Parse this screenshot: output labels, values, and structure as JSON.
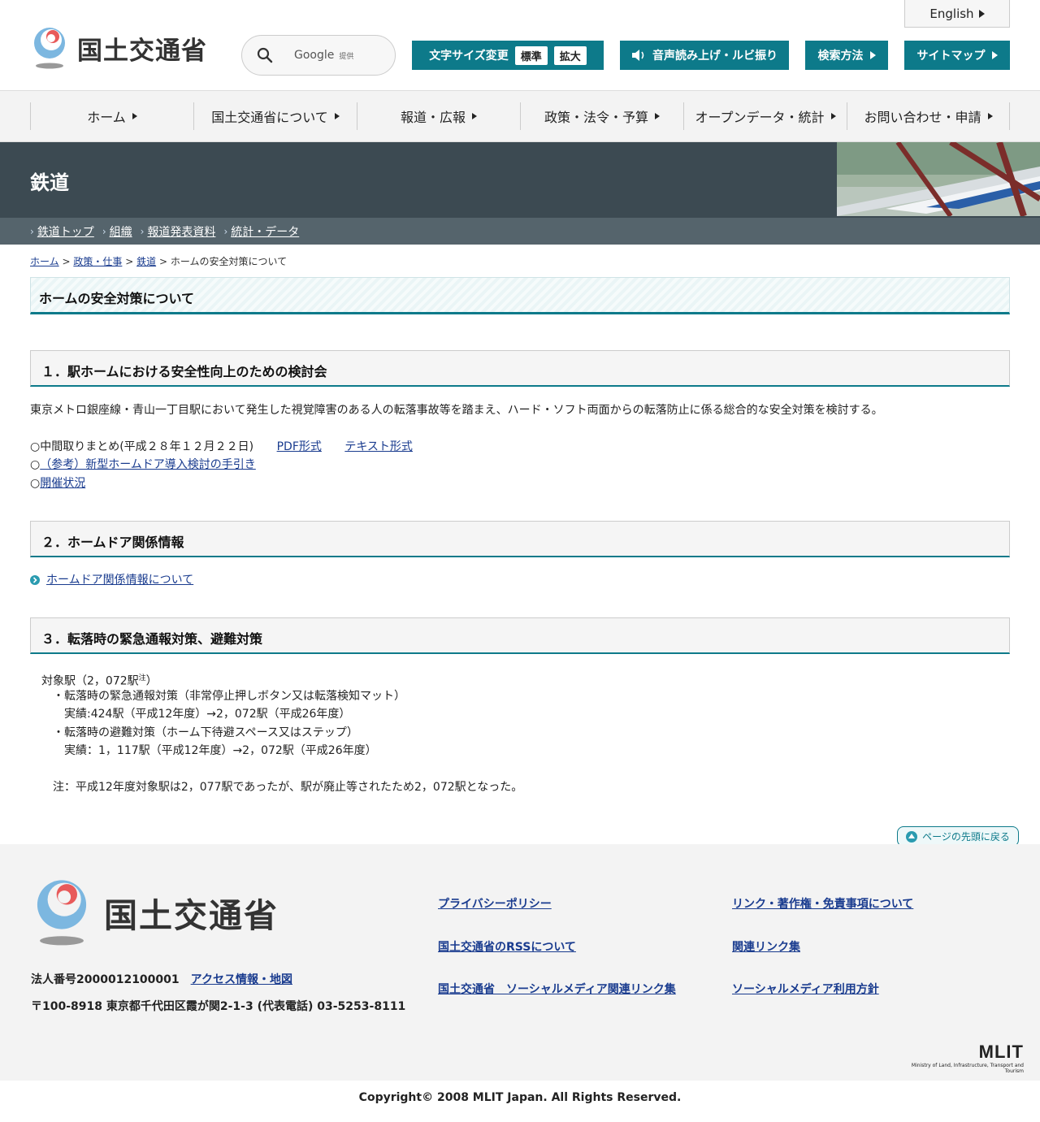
{
  "header": {
    "logo_text": "国土交通省",
    "english_label": "English",
    "search": {
      "provider": "Google",
      "provider_note": "提供"
    },
    "font_size": {
      "label": "文字サイズ変更",
      "standard": "標準",
      "large": "拡大"
    },
    "speech_label": "音声読み上げ・ルビ振り",
    "search_method_label": "検索方法",
    "sitemap_label": "サイトマップ"
  },
  "nav": {
    "items": [
      {
        "label": "ホーム"
      },
      {
        "label": "国土交通省について"
      },
      {
        "label": "報道・広報"
      },
      {
        "label": "政策・法令・予算"
      },
      {
        "label": "オープンデータ・統計"
      },
      {
        "label": "お問い合わせ・申請"
      }
    ]
  },
  "section": {
    "title": "鉄道",
    "subnav": [
      {
        "label": "鉄道トップ"
      },
      {
        "label": "組織"
      },
      {
        "label": "報道発表資料"
      },
      {
        "label": "統計・データ"
      }
    ]
  },
  "breadcrumb": {
    "home": "ホーム",
    "policy": "政策・仕事",
    "railway": "鉄道",
    "current": "ホームの安全対策について",
    "sep": ">"
  },
  "page": {
    "title": "ホームの安全対策について",
    "s1": {
      "heading": "１．駅ホームにおける安全性向上のための検討会",
      "body": "東京メトロ銀座線・青山一丁目駅において発生した視覚障害のある人の転落事故等を踏まえ、ハード・ソフト両面からの転落防止に係る総合的な安全対策を検討する。",
      "interim_prefix": "○中間取りまとめ(平成２８年１２月２２日)",
      "pdf_link": "PDF形式",
      "text_link": "テキスト形式",
      "bullet": "○",
      "guide_link": "（参考）新型ホームドア導入検討の手引き",
      "status_link": "開催状況"
    },
    "s2": {
      "heading": "２．ホームドア関係情報",
      "link": "ホームドア関係情報について"
    },
    "s3": {
      "heading": "３．転落時の緊急通報対策、避難対策",
      "target": "対象駅（2，072駅",
      "note_mark": "注",
      "target_close": "）",
      "line1": "・転落時の緊急通報対策（非常停止押しボタン又は転落検知マット）",
      "line2": "実績:424駅（平成12年度）→2，072駅（平成26年度）",
      "line3": "・転落時の避難対策（ホーム下待避スペース又はステップ）",
      "line4": "実績：1，117駅（平成12年度）→2，072駅（平成26年度）",
      "note": "注：平成12年度対象駅は2，077駅であったが、駅が廃止等されたため2，072駅となった。"
    },
    "to_top": "ページの先頭に戻る"
  },
  "footer": {
    "logo_text": "国土交通省",
    "corp_number": "法人番号2000012100001",
    "access_link": "アクセス情報・地図",
    "address": "〒100-8918 東京都千代田区霞が関2-1-3 (代表電話) 03-5253-8111",
    "links": {
      "privacy": "プライバシーポリシー",
      "link_copyright": "リンク・著作権・免責事項について",
      "rss": "国土交通省のRSSについて",
      "related": "関連リンク集",
      "social_links": "国土交通省　ソーシャルメディア関連リンク集",
      "social_policy": "ソーシャルメディア利用方針"
    },
    "mlit_mark": "MLIT",
    "mlit_full": "Ministry of Land, Infrastructure, Transport and Tourism",
    "copyright": "Copyright© 2008 MLIT Japan. All Rights Reserved."
  },
  "colors": {
    "accent": "#0d7a8a",
    "band": "#3c4a52",
    "subnav": "#55646c",
    "link": "#1a3c8f"
  }
}
